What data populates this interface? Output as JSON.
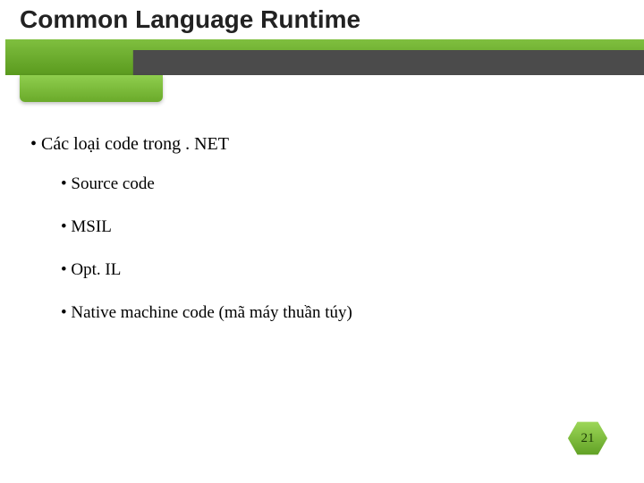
{
  "header": {
    "title": "Common Language Runtime"
  },
  "body": {
    "main": "Các loại code trong . NET",
    "items": [
      "Source code",
      "MSIL",
      "Opt. IL",
      "Native machine code (mã máy thuần túy)"
    ]
  },
  "page": {
    "number": "21"
  }
}
